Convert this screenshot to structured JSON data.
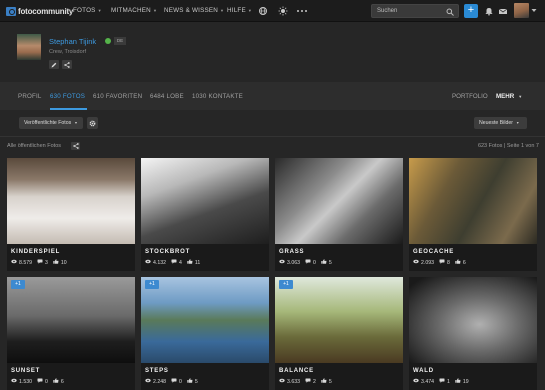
{
  "nav": {
    "logo_text": "fotocommunity",
    "items": [
      {
        "label": "FOTOS"
      },
      {
        "label": "MITMACHEN"
      },
      {
        "label": "NEWS & WISSEN"
      },
      {
        "label": "HILFE"
      }
    ],
    "search_placeholder": "Suchen",
    "plus_label": "+"
  },
  "profile": {
    "name": "Stephan Tijink",
    "lang": "DE",
    "subtitle": "Crew, Troisdorf"
  },
  "tabs": {
    "left": [
      {
        "label": "PROFIL"
      },
      {
        "label": "630 FOTOS"
      },
      {
        "label": "610 FAVORITEN"
      },
      {
        "label": "6484 LOBE"
      },
      {
        "label": "1030 KONTAKTE"
      }
    ],
    "portfolio": "PORTFOLIO",
    "more": "MEHR"
  },
  "filters": {
    "published": "Veröffentlichte Fotos",
    "sort": "Neueste Bilder"
  },
  "gallery": {
    "all_label": "Alle öffentlichen Fotos",
    "count_text": "623 Fotos | Seite 1 von 7",
    "photos": [
      {
        "title": "KINDERSPIEL",
        "views": "8.579",
        "comments": "3",
        "likes": "10",
        "badge": ""
      },
      {
        "title": "STOCKBROT",
        "views": "4.132",
        "comments": "4",
        "likes": "11",
        "badge": ""
      },
      {
        "title": "GRASS",
        "views": "3.063",
        "comments": "0",
        "likes": "5",
        "badge": ""
      },
      {
        "title": "GEOCACHE",
        "views": "2.093",
        "comments": "8",
        "likes": "6",
        "badge": ""
      },
      {
        "title": "SUNSET",
        "views": "1.530",
        "comments": "0",
        "likes": "6",
        "badge": "+1"
      },
      {
        "title": "STEPS",
        "views": "2.248",
        "comments": "0",
        "likes": "5",
        "badge": "+1"
      },
      {
        "title": "BALANCE",
        "views": "3.633",
        "comments": "2",
        "likes": "5",
        "badge": "+1"
      },
      {
        "title": "WALD",
        "views": "3.474",
        "comments": "1",
        "likes": "19",
        "badge": ""
      }
    ]
  },
  "colors": {
    "accent": "#3d9ae0",
    "online": "#55b34a",
    "badge": "#3d8ad0"
  }
}
